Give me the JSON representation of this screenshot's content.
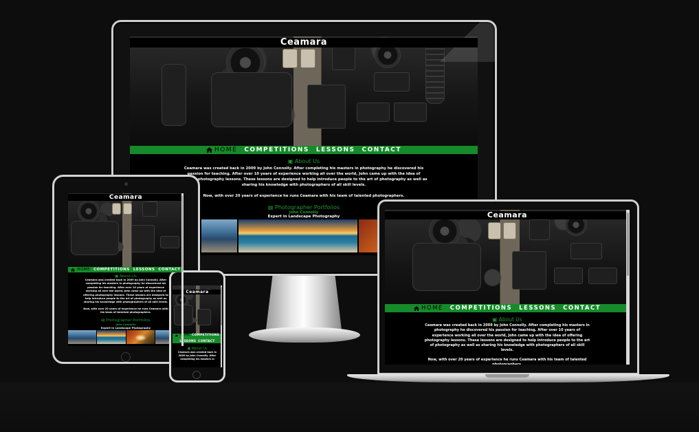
{
  "site": {
    "brand": "Ceamara",
    "nav": {
      "home": "HOME",
      "competitions": "COMPETITIONS",
      "lessons": "LESSONS",
      "contact": "CONTACT"
    },
    "about": {
      "heading": "About Us",
      "paragraph1": "Ceamara was created back in 2009 by John Connolly. After completing his masters in photography he discovered his passion for teaching. After over 10 years of experience working all over the world, John came up with the idea of offering photography lessons. These lessons are designed to help introduce people to the art of photography as well as sharing his knowledge with photographers of all skill levels.",
      "paragraph2": "Now, with over 20 years of experience he runs Ceamara with his team of talented photographers."
    },
    "portfolios": {
      "heading": "Photographer Portfolios",
      "name": "John Connolly",
      "role": "Expert in Landscape Photography"
    },
    "phone_about_text": "Ceamara was created back in 2009 by John Connolly. After completing his masters in"
  },
  "colors": {
    "background": "#0d0d0d",
    "nav_green": "#168a2a",
    "heading_green": "#1f9b35"
  }
}
